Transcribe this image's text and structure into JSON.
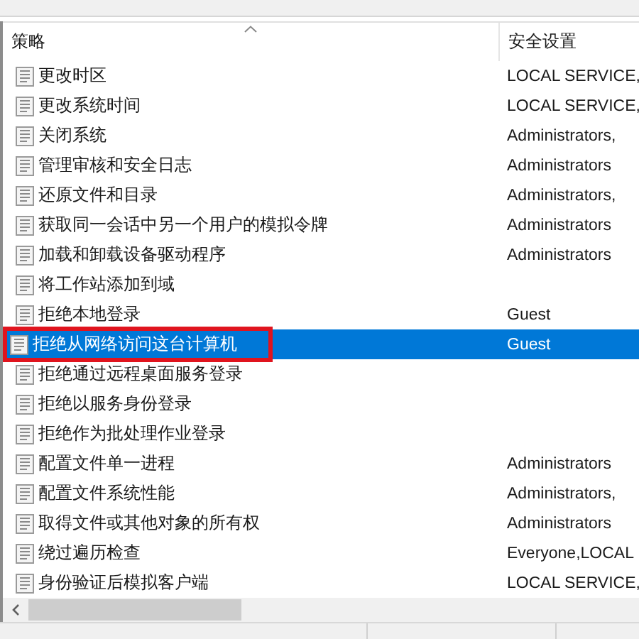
{
  "table": {
    "columns": [
      {
        "label": "策略",
        "sorted": true
      },
      {
        "label": "安全设置",
        "sorted": false
      }
    ],
    "rows": [
      {
        "policy": "更改时区",
        "setting": "LOCAL SERVICE,",
        "selected": false,
        "highlighted": false
      },
      {
        "policy": "更改系统时间",
        "setting": "LOCAL SERVICE,",
        "selected": false,
        "highlighted": false
      },
      {
        "policy": "关闭系统",
        "setting": "Administrators,",
        "selected": false,
        "highlighted": false
      },
      {
        "policy": "管理审核和安全日志",
        "setting": "Administrators",
        "selected": false,
        "highlighted": false
      },
      {
        "policy": "还原文件和目录",
        "setting": "Administrators,",
        "selected": false,
        "highlighted": false
      },
      {
        "policy": "获取同一会话中另一个用户的模拟令牌",
        "setting": "Administrators",
        "selected": false,
        "highlighted": false
      },
      {
        "policy": "加载和卸载设备驱动程序",
        "setting": "Administrators",
        "selected": false,
        "highlighted": false
      },
      {
        "policy": "将工作站添加到域",
        "selected": false,
        "highlighted": false
      },
      {
        "policy": "拒绝本地登录",
        "setting": "Guest",
        "selected": false,
        "highlighted": false
      },
      {
        "policy": "拒绝从网络访问这台计算机",
        "setting": "Guest",
        "selected": true,
        "highlighted": true
      },
      {
        "policy": "拒绝通过远程桌面服务登录",
        "selected": false,
        "highlighted": false
      },
      {
        "policy": "拒绝以服务身份登录",
        "selected": false,
        "highlighted": false
      },
      {
        "policy": "拒绝作为批处理作业登录",
        "selected": false,
        "highlighted": false
      },
      {
        "policy": "配置文件单一进程",
        "setting": "Administrators",
        "selected": false,
        "highlighted": false
      },
      {
        "policy": "配置文件系统性能",
        "setting": "Administrators,",
        "selected": false,
        "highlighted": false
      },
      {
        "policy": "取得文件或其他对象的所有权",
        "setting": "Administrators",
        "selected": false,
        "highlighted": false
      },
      {
        "policy": "绕过遍历检查",
        "setting": "Everyone,LOCAL",
        "selected": false,
        "highlighted": false
      },
      {
        "policy": "身份验证后模拟客户端",
        "setting": "LOCAL SERVICE,",
        "selected": false,
        "highlighted": false
      }
    ]
  }
}
